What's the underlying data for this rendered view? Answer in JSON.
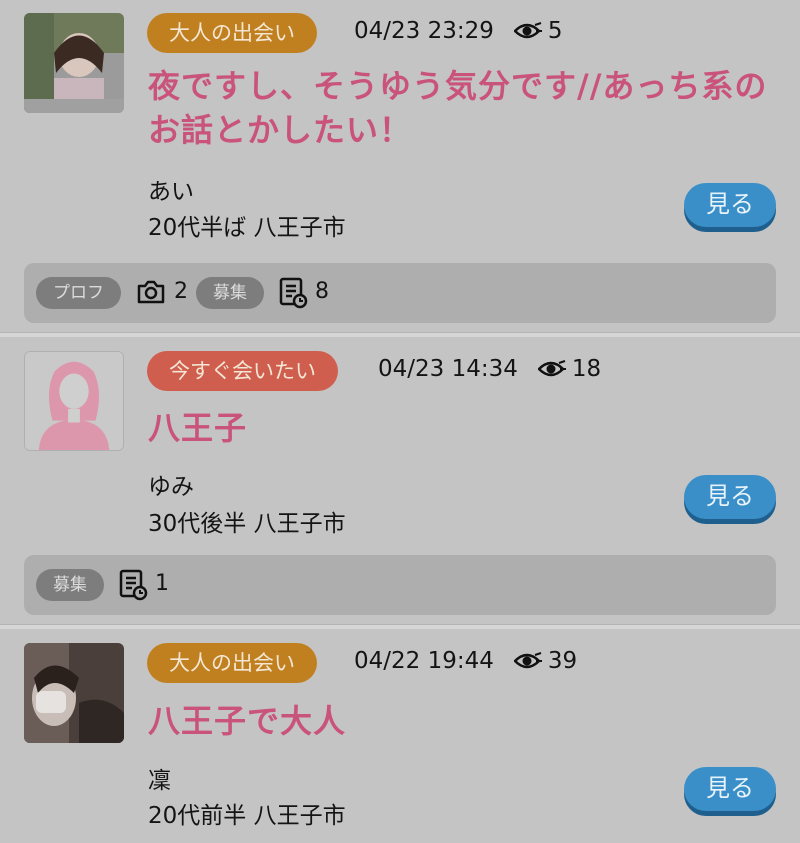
{
  "colors": {
    "badge_adult": "#c0801f",
    "badge_now": "#cf5e4e",
    "title_pink": "#c9537a",
    "button_blue": "#3a8fc9"
  },
  "posts": [
    {
      "category": "大人の出会い",
      "date": "04/23 23:29",
      "views": "5",
      "title": "夜ですし、そうゆう気分です//あっち系のお話とかしたい！",
      "name": "あい",
      "age_location": "20代半ば 八王子市",
      "view_button": "見る",
      "footer": {
        "profile_chip": "プロフ",
        "photo_count": "2",
        "recruit_chip": "募集",
        "recruit_count": "8"
      }
    },
    {
      "category": "今すぐ会いたい",
      "date": "04/23 14:34",
      "views": "18",
      "title": "八王子",
      "name": "ゆみ",
      "age_location": "30代後半 八王子市",
      "view_button": "見る",
      "footer": {
        "recruit_chip": "募集",
        "recruit_count": "1"
      }
    },
    {
      "category": "大人の出会い",
      "date": "04/22 19:44",
      "views": "39",
      "title": "八王子で大人",
      "name": "凜",
      "age_location": "20代前半 八王子市",
      "view_button": "見る"
    }
  ]
}
